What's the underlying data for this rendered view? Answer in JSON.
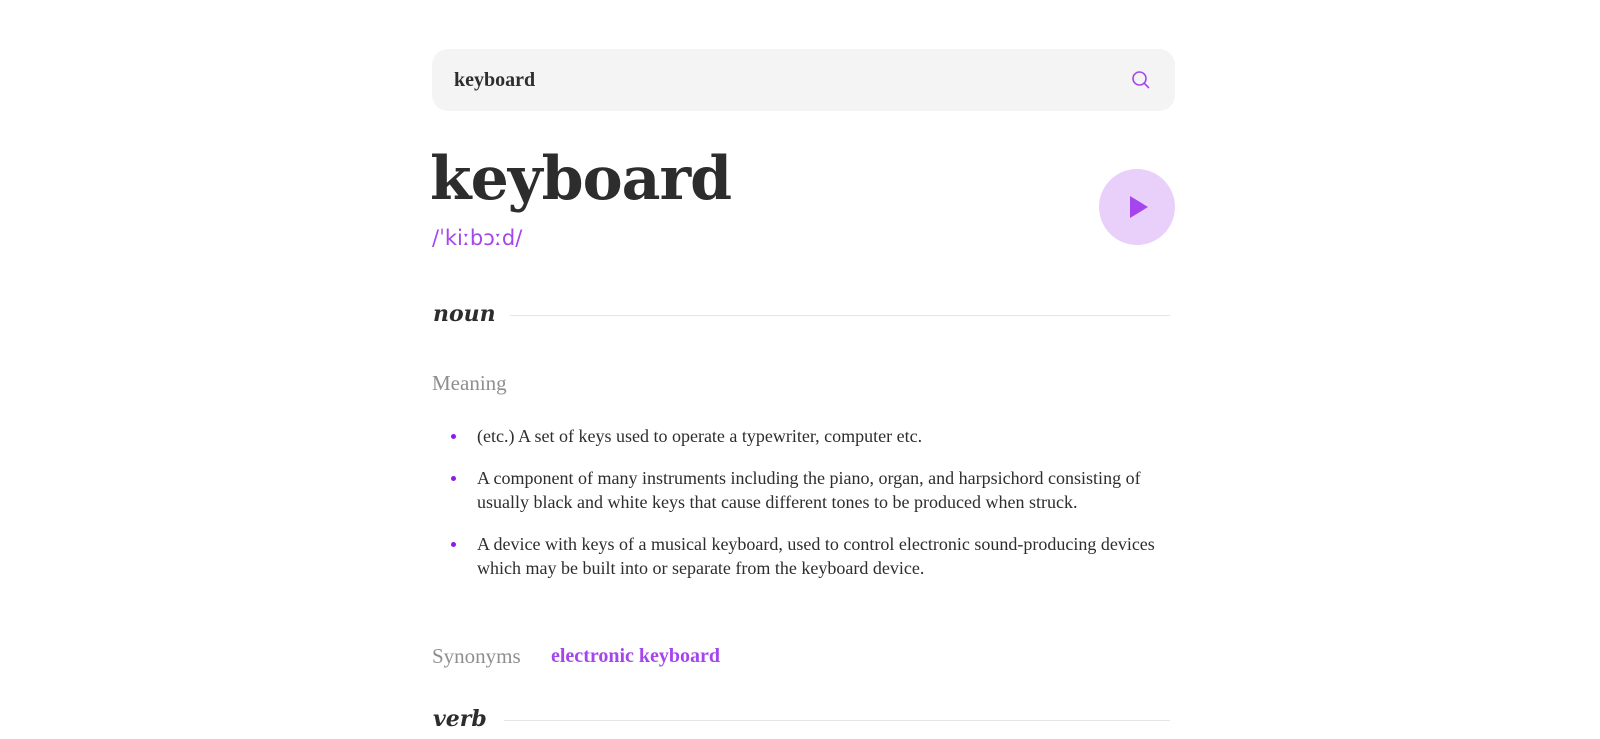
{
  "search": {
    "value": "keyboard",
    "icon": "search-icon"
  },
  "entry": {
    "word": "keyboard",
    "phonetic": "/ˈkiːbɔːd/",
    "play_icon": "play-icon"
  },
  "meanings": [
    {
      "part_of_speech": "noun",
      "meaning_label": "Meaning",
      "definitions": [
        "(etc.) A set of keys used to operate a typewriter, computer etc.",
        "A component of many instruments including the piano, organ, and harpsichord consisting of usually black and white keys that cause different tones to be produced when struck.",
        "A device with keys of a musical keyboard, used to control electronic sound-producing devices which may be built into or separate from the keyboard device."
      ],
      "synonyms_label": "Synonyms",
      "synonyms": [
        "electronic keyboard"
      ]
    },
    {
      "part_of_speech": "verb"
    }
  ],
  "colors": {
    "accent": "#A445ED",
    "accent_light": "#E9D0FA",
    "text": "#2D2D2D",
    "muted": "#8F8F8F",
    "search_bg": "#F4F4F4"
  }
}
